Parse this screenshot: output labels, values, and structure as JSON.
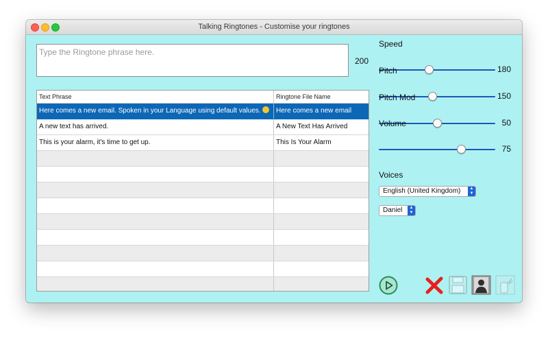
{
  "window": {
    "title": "Talking Ringtones - Customise your ringtones"
  },
  "phrase": {
    "placeholder": "Type the Ringtone phrase here.",
    "char_count": "200"
  },
  "table": {
    "headers": [
      "Text Phrase",
      "Ringtone File Name"
    ],
    "rows": [
      {
        "phrase": "Here comes a new email. Spoken in your Language using default values.",
        "file": "Here comes a new email"
      },
      {
        "phrase": "A new text has arrived.",
        "file": "A New Text Has Arrived"
      },
      {
        "phrase": "This is your alarm, it's time to get up.",
        "file": "This Is Your Alarm"
      }
    ]
  },
  "sliders": {
    "speed": {
      "label": "Speed",
      "value": "180",
      "fraction": 0.43
    },
    "pitch": {
      "label": "Pitch",
      "value": "150",
      "fraction": 0.46
    },
    "pitch_mod": {
      "label": "Pitch Mod",
      "value": "50",
      "fraction": 0.5
    },
    "volume": {
      "label": "Volume",
      "value": "75",
      "fraction": 0.71
    }
  },
  "voices": {
    "label": "Voices",
    "language": "English (United Kingdom)",
    "voice": "Daniel"
  },
  "icons": {
    "play": "play-icon",
    "delete": "red-x-icon",
    "save": "floppy-disk-icon",
    "contact": "contact-silhouette-icon",
    "phone": "phone-icon"
  },
  "colors": {
    "background": "#aef1f2",
    "selection": "#0c67b6",
    "slider_fill": "#1f56b6",
    "delete_red": "#e8201c",
    "play_green": "#2c8a56"
  }
}
